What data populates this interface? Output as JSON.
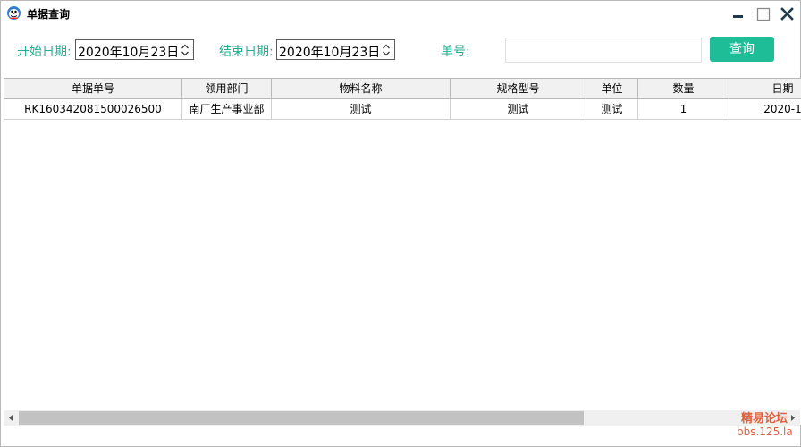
{
  "window": {
    "title": "单据查询",
    "icons": {
      "app": "app-logo-icon",
      "minimize": "minimize-icon",
      "maximize": "maximize-icon",
      "close": "close-icon"
    }
  },
  "filters": {
    "start_label": "开始日期:",
    "start_value": "2020年10月23日",
    "end_label": "结束日期:",
    "end_value": "2020年10月23日",
    "number_label": "单号:",
    "number_value": "",
    "query_label": "查询"
  },
  "grid": {
    "columns": [
      "单据单号",
      "领用部门",
      "物料名称",
      "规格型号",
      "单位",
      "数量",
      "日期"
    ],
    "rows": [
      [
        "RK160342081500026500",
        "南厂生产事业部",
        "测试",
        "测试",
        "测试",
        "1",
        "2020-1"
      ]
    ]
  },
  "watermark": {
    "line1": "精易论坛",
    "line2": "bbs.125.la"
  },
  "colors": {
    "accent": "#1ebc97",
    "label": "#1aaf8f",
    "watermark": "#e0603c"
  }
}
